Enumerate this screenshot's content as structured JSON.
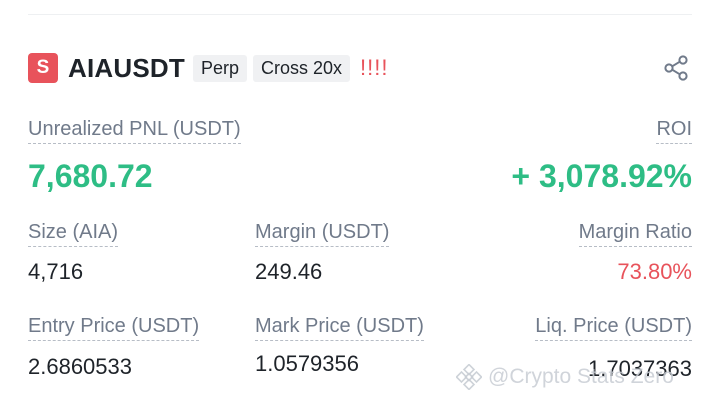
{
  "position": {
    "side_badge": "S",
    "symbol": "AIAUSDT",
    "type_tag": "Perp",
    "margin_tag": "Cross 20x",
    "alert_marks": "!!!!"
  },
  "icons": {
    "share": "share-icon",
    "watermark_logo": "binance-logo-icon"
  },
  "pnl": {
    "label": "Unrealized PNL (USDT)",
    "value": "7,680.72"
  },
  "roi": {
    "label": "ROI",
    "value": "+ 3,078.92%"
  },
  "stats_row1": {
    "size_label": "Size (AIA)",
    "size_value": "4,716",
    "margin_label": "Margin (USDT)",
    "margin_value": "249.46",
    "margin_ratio_label": "Margin Ratio",
    "margin_ratio_value": "73.80%"
  },
  "stats_row2": {
    "entry_label": "Entry Price (USDT)",
    "entry_value": "2.6860533",
    "mark_label": "Mark Price (USDT)",
    "mark_value": "1.0579356",
    "liq_label": "Liq. Price (USDT)",
    "liq_value": "1.7037363"
  },
  "watermark": {
    "text": "@Crypto Stats Zero"
  },
  "colors": {
    "positive": "#2ebd85",
    "negative": "#e8535b",
    "muted": "#707a8a",
    "text": "#1e2329"
  }
}
